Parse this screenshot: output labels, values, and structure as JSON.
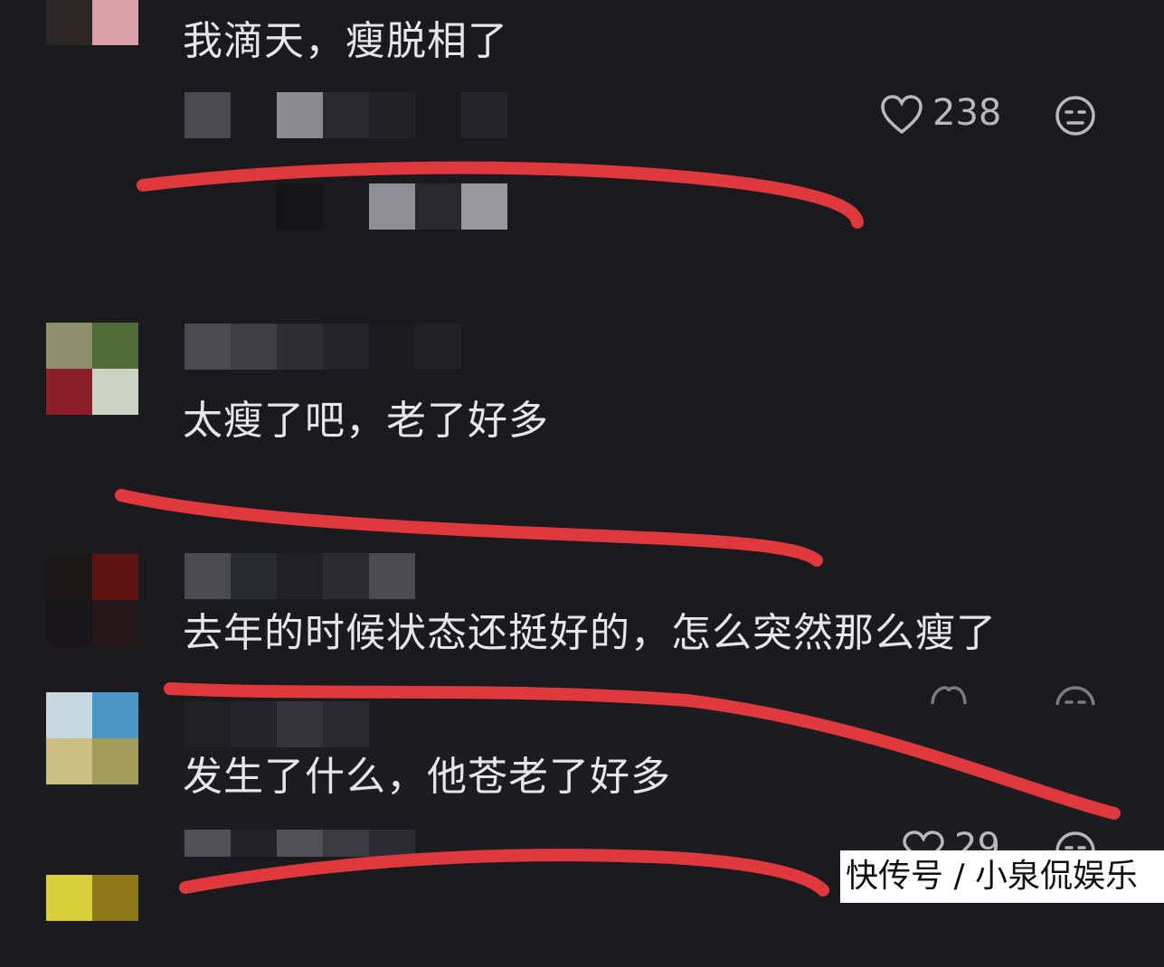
{
  "comments": [
    {
      "text": "我滴天，瘦脱相了",
      "likes": "238"
    },
    {
      "text": "太瘦了吧，老了好多"
    },
    {
      "text": "去年的时候状态还挺好的，怎么突然那么瘦了"
    },
    {
      "text": "发生了什么，他苍老了好多"
    },
    {
      "likes": "29"
    }
  ],
  "watermark": "快传号 / 小泉侃娱乐",
  "icons": [
    "heart-icon",
    "emoji-reaction-icon"
  ],
  "colors": {
    "background": "#1b1a1f",
    "annotation": "#e0393d",
    "text": "#e6e6e8"
  }
}
